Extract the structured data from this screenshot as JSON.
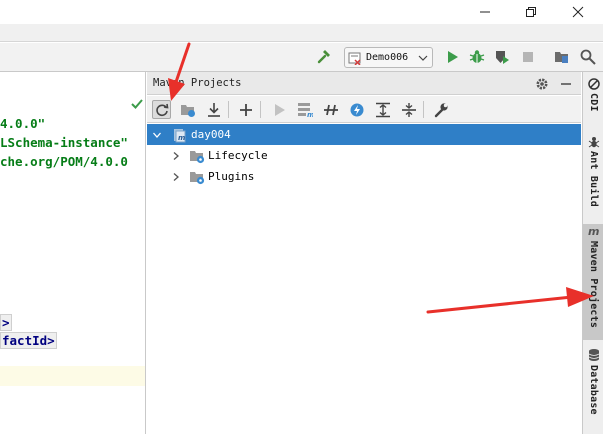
{
  "window": {
    "minimize_icon": "minimize-icon",
    "maximize_icon": "restore-icon",
    "close_icon": "close-icon"
  },
  "toolbar": {
    "build_icon": "hammer-icon",
    "run_config": "Demo006",
    "run_icon": "run-icon",
    "debug_icon": "debug-icon",
    "coverage_icon": "coverage-icon",
    "stop_icon": "stop-icon",
    "project_structure_icon": "project-structure-icon",
    "search_icon": "search-icon"
  },
  "editor": {
    "lines": [
      "4.0.0\"",
      "LSchema-instance\"",
      "che.org/POM/4.0.0"
    ],
    "tag_lines": [
      ">",
      "factId>"
    ]
  },
  "maven": {
    "title": "Maven Projects",
    "tree": [
      {
        "label": "day004",
        "selected": true,
        "expanded": true
      },
      {
        "label": "Lifecycle",
        "selected": false,
        "expanded": false
      },
      {
        "label": "Plugins",
        "selected": false,
        "expanded": false
      }
    ]
  },
  "right_strip": {
    "tabs": [
      {
        "label": "CDI",
        "active": false
      },
      {
        "label": "Ant Build",
        "active": false
      },
      {
        "label": "Maven Projects",
        "active": true
      },
      {
        "label": "Database",
        "active": false
      }
    ]
  },
  "colors": {
    "selection": "#2f7fc7",
    "accent_green": "#3c9c4a",
    "annotation_red": "#e8302a"
  }
}
